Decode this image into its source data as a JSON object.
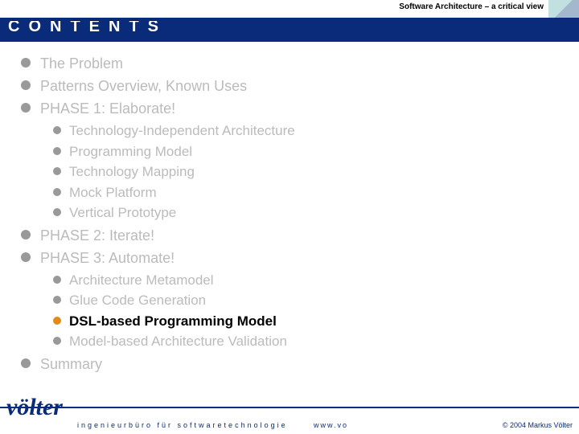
{
  "header": {
    "subtitle": "Software Architecture – a critical view",
    "title": "CONTENTS"
  },
  "bullets": [
    {
      "text": "The Problem",
      "muted": true
    },
    {
      "text": "Patterns Overview, Known Uses",
      "muted": true
    },
    {
      "text": "PHASE 1: Elaborate!",
      "muted": true,
      "children": [
        {
          "text": "Technology-Independent Architecture",
          "muted": true
        },
        {
          "text": "Programming Model",
          "muted": true
        },
        {
          "text": "Technology Mapping",
          "muted": true
        },
        {
          "text": "Mock Platform",
          "muted": true
        },
        {
          "text": "Vertical Prototype",
          "muted": true
        }
      ]
    },
    {
      "text": "PHASE 2: Iterate!",
      "muted": true
    },
    {
      "text": "PHASE 3: Automate!",
      "muted": true,
      "children": [
        {
          "text": "Architecture Metamodel",
          "muted": true
        },
        {
          "text": "Glue Code Generation",
          "muted": true
        },
        {
          "text": "DSL-based Programming Model",
          "bold": true,
          "highlight": true
        },
        {
          "text": "Model-based Architecture Validation",
          "muted": true
        }
      ]
    },
    {
      "text": "Summary",
      "muted": true
    }
  ],
  "footer": {
    "logo": "völter",
    "tagline": "ingenieurbüro für softwaretechnologie",
    "url": "www.vo",
    "copyright": "© 2004  Markus Völter"
  }
}
